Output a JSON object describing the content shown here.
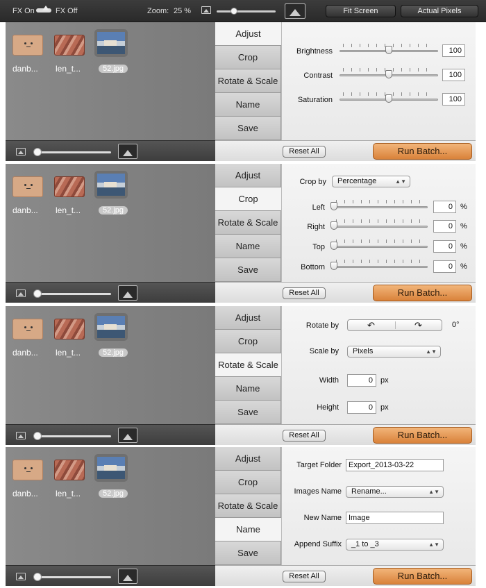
{
  "toolbar": {
    "fx_on": "FX On",
    "fx_off": "FX Off",
    "zoom_label": "Zoom:",
    "zoom_value": "25 %",
    "fit_screen": "Fit Screen",
    "actual_pixels": "Actual Pixels"
  },
  "thumbnails": [
    {
      "label": "danb..."
    },
    {
      "label": "len_t..."
    },
    {
      "label": "52.jpg"
    }
  ],
  "tabs": [
    "Adjust",
    "Crop",
    "Rotate & Scale",
    "Name",
    "Save"
  ],
  "footer": {
    "reset_all": "Reset All",
    "run_batch": "Run Batch..."
  },
  "adjust": {
    "brightness_label": "Brightness",
    "brightness_value": "100",
    "brightness_level": 0.5,
    "contrast_label": "Contrast",
    "contrast_value": "100",
    "contrast_level": 0.5,
    "saturation_label": "Saturation",
    "saturation_value": "100",
    "saturation_level": 0.5
  },
  "crop": {
    "crop_by_label": "Crop by",
    "crop_by_value": "Percentage",
    "left_label": "Left",
    "left_value": "0",
    "right_label": "Right",
    "right_value": "0",
    "top_label": "Top",
    "top_value": "0",
    "bottom_label": "Bottom",
    "bottom_value": "0",
    "unit": "%"
  },
  "rotate_scale": {
    "rotate_by_label": "Rotate by",
    "rotate_value": "0°",
    "scale_by_label": "Scale by",
    "scale_by_value": "Pixels",
    "width_label": "Width",
    "width_value": "0",
    "height_label": "Height",
    "height_value": "0",
    "unit": "px"
  },
  "name": {
    "target_folder_label": "Target Folder",
    "target_folder_value": "Export_2013-03-22",
    "images_name_label": "Images Name",
    "images_name_value": "Rename...",
    "new_name_label": "New Name",
    "new_name_value": "Image",
    "append_suffix_label": "Append Suffix",
    "append_suffix_value": "_1 to _3"
  }
}
